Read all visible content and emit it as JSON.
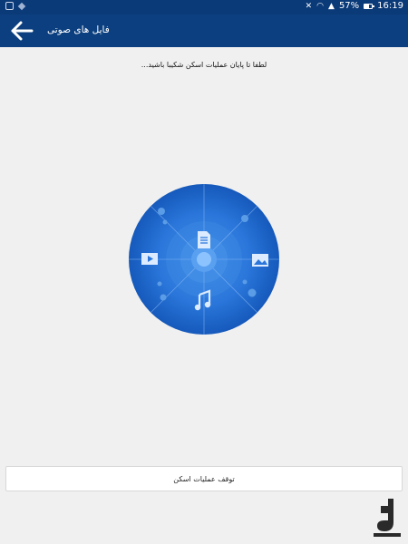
{
  "status_bar": {
    "battery": "57%",
    "time": "16:19"
  },
  "toolbar": {
    "title": "فایل های صوتی"
  },
  "main": {
    "message": "لطفا تا پایان عملیات اسکن شکیبا باشید...",
    "stop_button_label": "توقف عملیات اسکن"
  },
  "scanner": {
    "icons": [
      "document-icon",
      "image-icon",
      "music-icon",
      "video-icon"
    ]
  },
  "colors": {
    "toolbar": "#0b3f7f",
    "status_bar": "#0b3a78",
    "scanner_dark": "#1a63c8",
    "scanner_light": "#3d8ae6",
    "background": "#f0f0f0"
  }
}
